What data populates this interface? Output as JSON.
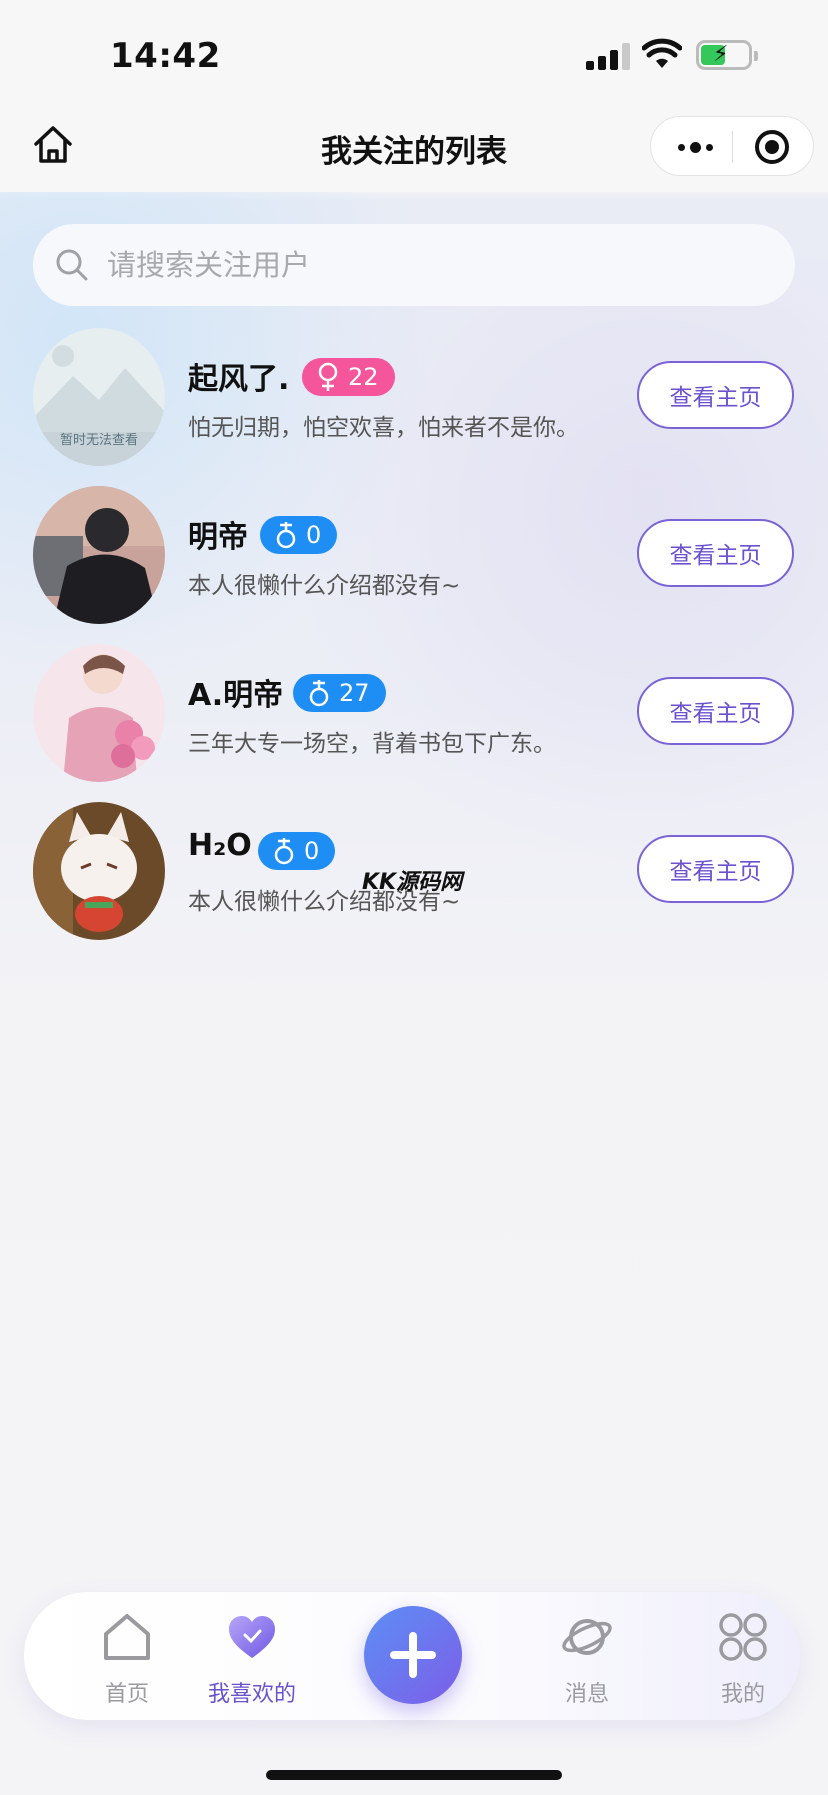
{
  "status_bar": {
    "time": "14:42"
  },
  "nav": {
    "title": "我关注的列表"
  },
  "search": {
    "placeholder": "请搜索关注用户"
  },
  "users": [
    {
      "name": "起风了.",
      "gender": "female",
      "age": "22",
      "bio": "怕无归期，怕空欢喜，怕来者不是你。",
      "button": "查看主页",
      "avatar_text": "暂时无法查看"
    },
    {
      "name": "明帝",
      "gender": "male",
      "age": "0",
      "bio": "本人很懒什么介绍都没有~",
      "button": "查看主页"
    },
    {
      "name": "A.明帝",
      "gender": "male",
      "age": "27",
      "bio": "三年大专一场空，背着书包下广东。",
      "button": "查看主页"
    },
    {
      "name": "H₂O",
      "gender": "male",
      "age": "0",
      "bio": "本人很懒什么介绍都没有~",
      "button": "查看主页"
    }
  ],
  "watermark": "KK源码网",
  "tab_bar": {
    "items": [
      {
        "label": "首页",
        "icon": "home-icon"
      },
      {
        "label": "我喜欢的",
        "icon": "heart-icon",
        "active": true
      },
      {
        "label": "",
        "icon": "plus-icon"
      },
      {
        "label": "消息",
        "icon": "planet-icon"
      },
      {
        "label": "我的",
        "icon": "grid-icon"
      }
    ]
  },
  "colors": {
    "accent": "#6a52cf",
    "female": "#f5559b",
    "male": "#1e8ef5",
    "fab_start": "#5c8ff5",
    "fab_end": "#7c5ee8"
  }
}
